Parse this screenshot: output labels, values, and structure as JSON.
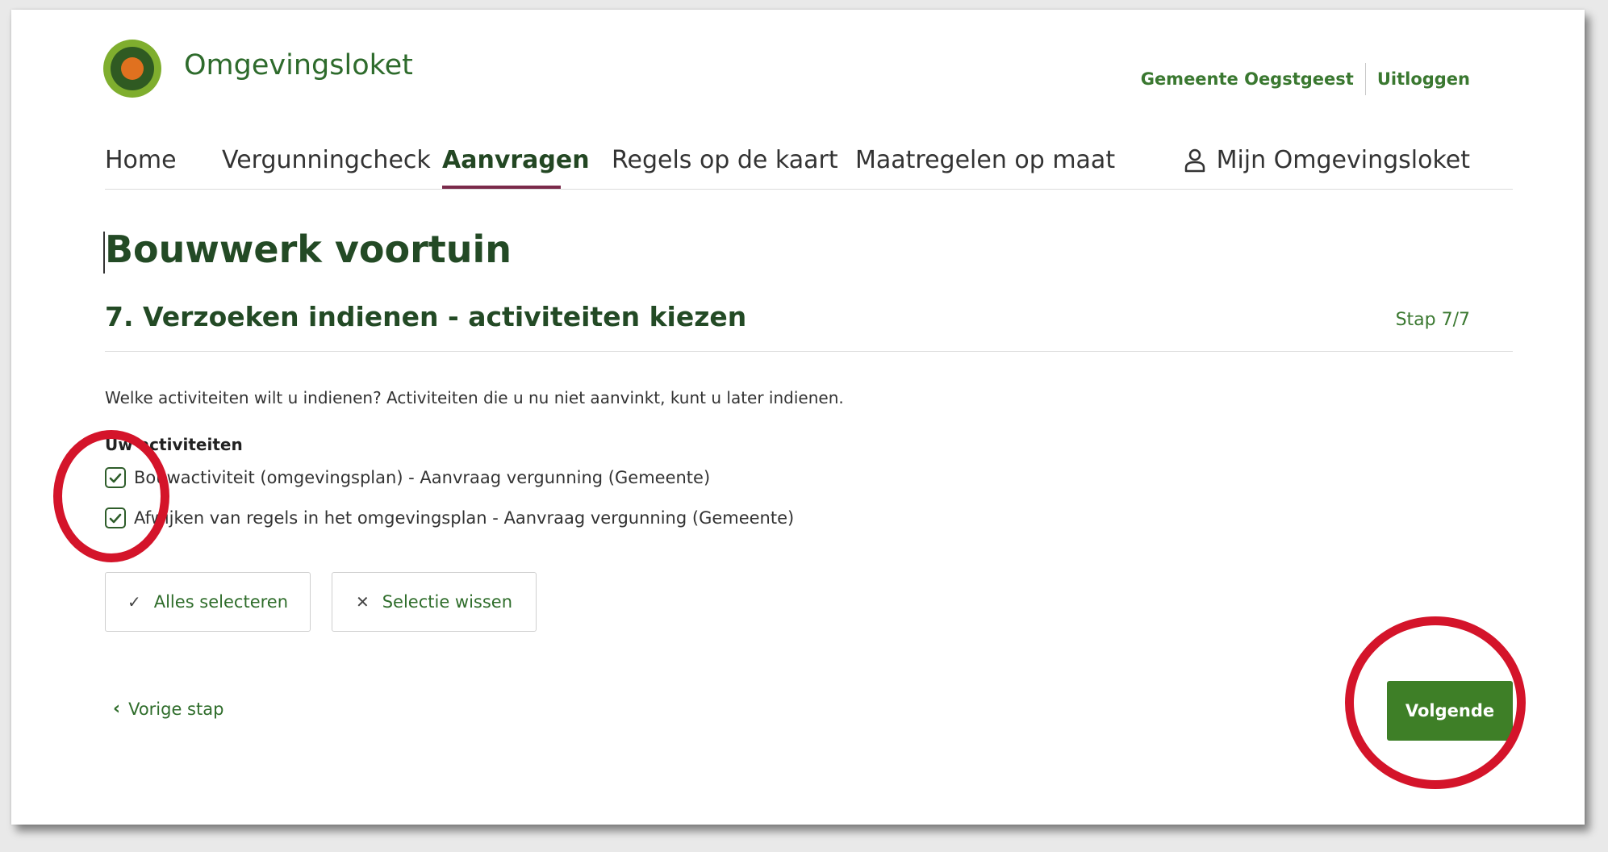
{
  "header": {
    "brand": "Omgevingsloket",
    "municipality": "Gemeente Oegstgeest",
    "logout": "Uitloggen"
  },
  "nav": {
    "items": [
      {
        "label": "Home"
      },
      {
        "label": "Vergunningcheck"
      },
      {
        "label": "Aanvragen",
        "active": true
      },
      {
        "label": "Regels op de kaart"
      },
      {
        "label": "Maatregelen op maat"
      }
    ],
    "account": "Mijn Omgevingsloket"
  },
  "page": {
    "title": "Bouwwerk voortuin",
    "section_title": "7. Verzoeken indienen - activiteiten kiezen",
    "step": "Stap 7/7",
    "question": "Welke activiteiten wilt u indienen? Activiteiten die u nu niet aanvinkt, kunt u later indienen.",
    "group_label": "Uw activiteiten"
  },
  "activities": [
    {
      "label": "Bouwactiviteit (omgevingsplan) - Aanvraag vergunning (Gemeente)",
      "checked": true
    },
    {
      "label": "Afwijken van regels in het omgevingsplan - Aanvraag vergunning (Gemeente)",
      "checked": true
    }
  ],
  "actions": {
    "select_all": "Alles selecteren",
    "clear_selection": "Selectie wissen",
    "previous": "Vorige stap",
    "next": "Volgende"
  },
  "colors": {
    "brand_green": "#3e7f27",
    "heading_green": "#234a25",
    "nav_active_underline": "#7a2a4a",
    "annotation_red": "#d4142a"
  }
}
